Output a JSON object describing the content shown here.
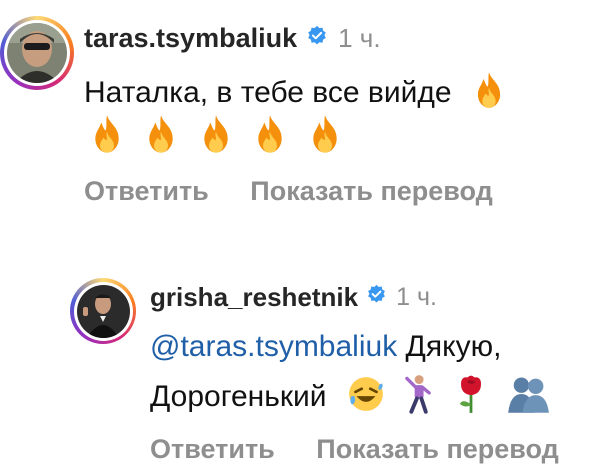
{
  "comments": [
    {
      "username": "taras.tsymbaliuk",
      "time": "1 ч.",
      "line1": "Наталка, в тебе все вийде",
      "reply_label": "Ответить",
      "translate_label": "Показать перевод"
    },
    {
      "username": "grisha_reshetnik",
      "time": "1 ч.",
      "mention": "@taras.tsymbaliuk",
      "line1_rest": " Дякую,",
      "line2": "Дорогенький",
      "reply_label": "Ответить",
      "translate_label": "Показать перевод"
    }
  ],
  "icons": {
    "verified": "verified-badge-icon",
    "fire": "fire-emoji",
    "laugh": "rolling-laughing-emoji",
    "dancer": "man-dancing-emoji",
    "rose": "rose-emoji",
    "hug": "people-hugging-emoji"
  },
  "colors": {
    "username": "#262626",
    "muted": "#8e8e8e",
    "mention": "#1f5fa8",
    "verified": "#3897f0"
  }
}
